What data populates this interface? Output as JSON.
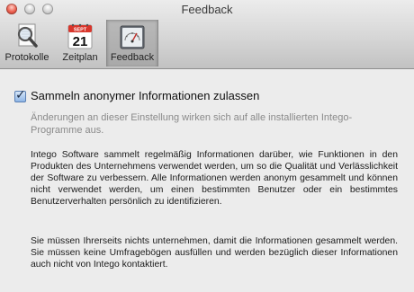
{
  "window": {
    "title": "Feedback"
  },
  "toolbar": {
    "items": [
      {
        "label": "Protokolle",
        "icon": "magnifier-document-icon"
      },
      {
        "label": "Zeitplan",
        "icon": "calendar-icon",
        "calendar_day": "21",
        "calendar_month": "SEPT"
      },
      {
        "label": "Feedback",
        "icon": "gauge-icon",
        "selected": true
      }
    ]
  },
  "settings": {
    "checkbox_label": "Sammeln anonymer Informationen zulassen",
    "checkbox_checked": true,
    "hint": "Änderungen an dieser Einstellung wirken sich auf alle installierten Intego-Programme aus.",
    "paragraph1": "Intego Software sammelt regelmäßig Informationen darüber, wie Funktionen in den Produkten des Unternehmens verwendet werden, um so die Qualität und Verlässlichkeit der Software zu verbessern. Alle Informationen werden anonym gesammelt und können nicht verwendet werden, um einen bestimmten Benutzer oder ein bestimmtes Benutzerverhalten persönlich zu identifizieren.",
    "paragraph2": "Sie müssen Ihrerseits nichts unternehmen, damit die Informationen gesammelt werden. Sie müssen keine Umfragebögen ausfüllen und werden bezüglich dieser Informationen auch nicht von Intego kontaktiert."
  }
}
